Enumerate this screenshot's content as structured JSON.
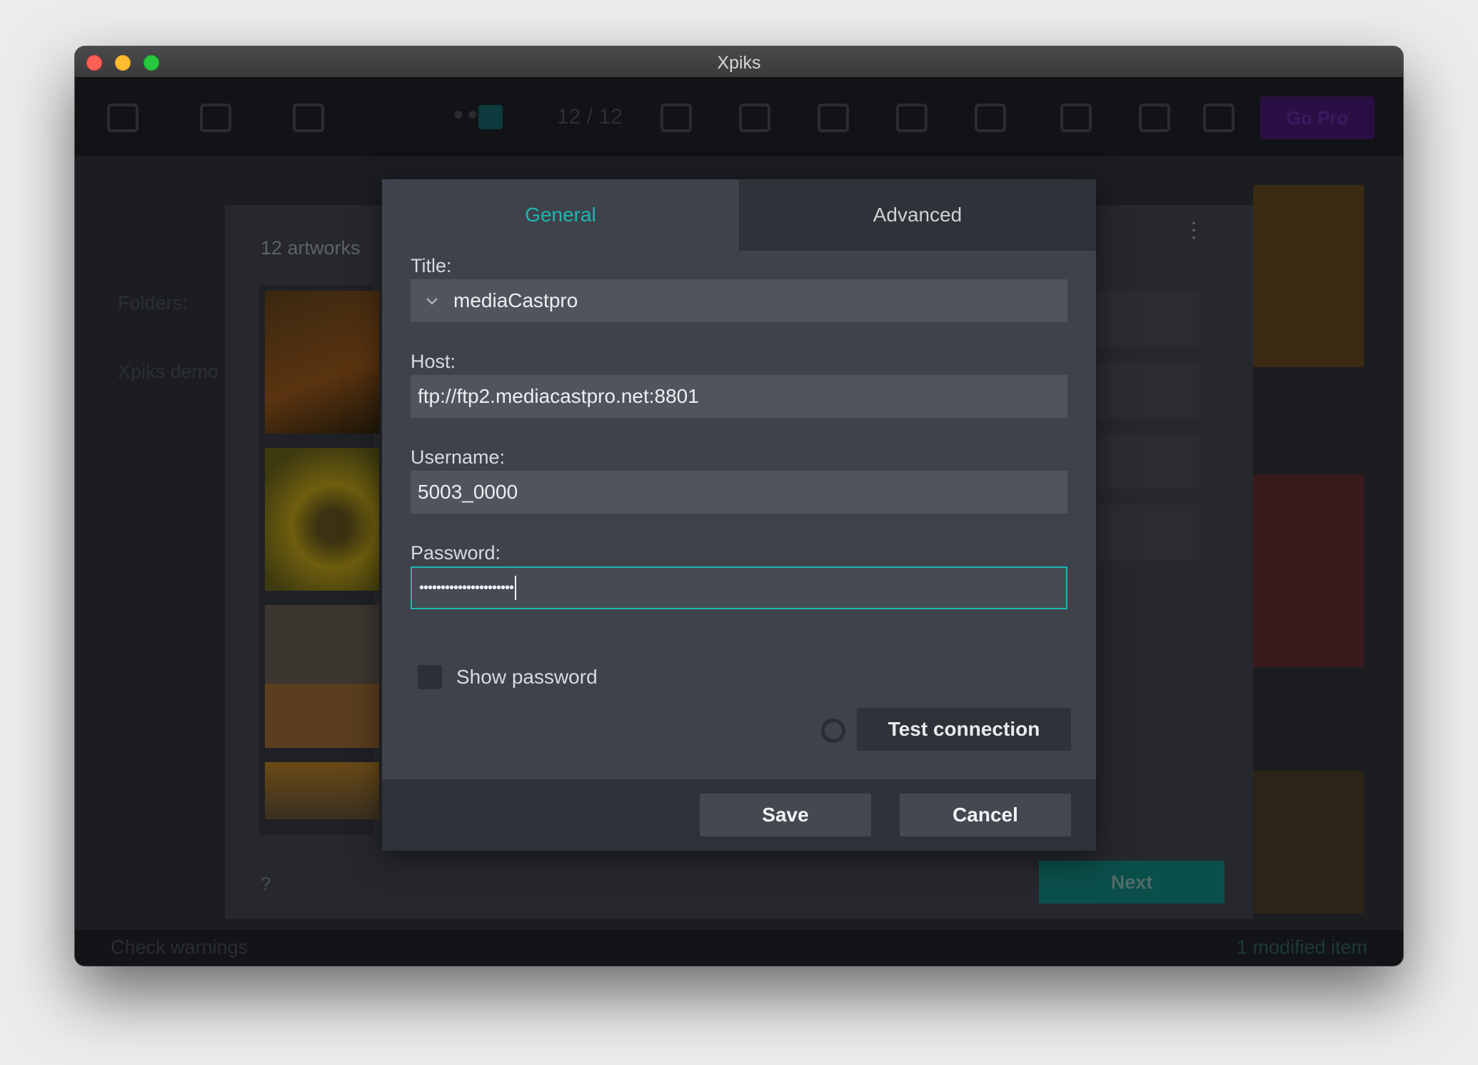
{
  "window": {
    "title": "Xpiks"
  },
  "toolbar": {
    "counter": "12 / 12",
    "gopro_label": "Go Pro"
  },
  "sidebar": {
    "folders_label": "Folders:",
    "folder_name": "Xpiks demo"
  },
  "status": {
    "left": "Check warnings",
    "right": "1 modified item"
  },
  "upload": {
    "artworks_count": "12 artworks",
    "help_label": "?",
    "next_label": "Next",
    "kebab": "⋮"
  },
  "modal": {
    "tabs": [
      {
        "label": "General",
        "active": true
      },
      {
        "label": "Advanced",
        "active": false
      }
    ],
    "title_label": "Title:",
    "title_value": "mediaCastpro",
    "host_label": "Host:",
    "host_value": "ftp://ftp2.mediacastpro.net:8801",
    "username_label": "Username:",
    "username_value": "5003_0000",
    "password_label": "Password:",
    "password_mask": "••••••••••••••••••••••",
    "show_password_label": "Show password",
    "show_password_checked": false,
    "test_connection_label": "Test connection",
    "save_label": "Save",
    "cancel_label": "Cancel"
  },
  "colors": {
    "accent": "#1fb6b0",
    "modal_bg": "#3e424b",
    "field_bg": "#50545d"
  }
}
